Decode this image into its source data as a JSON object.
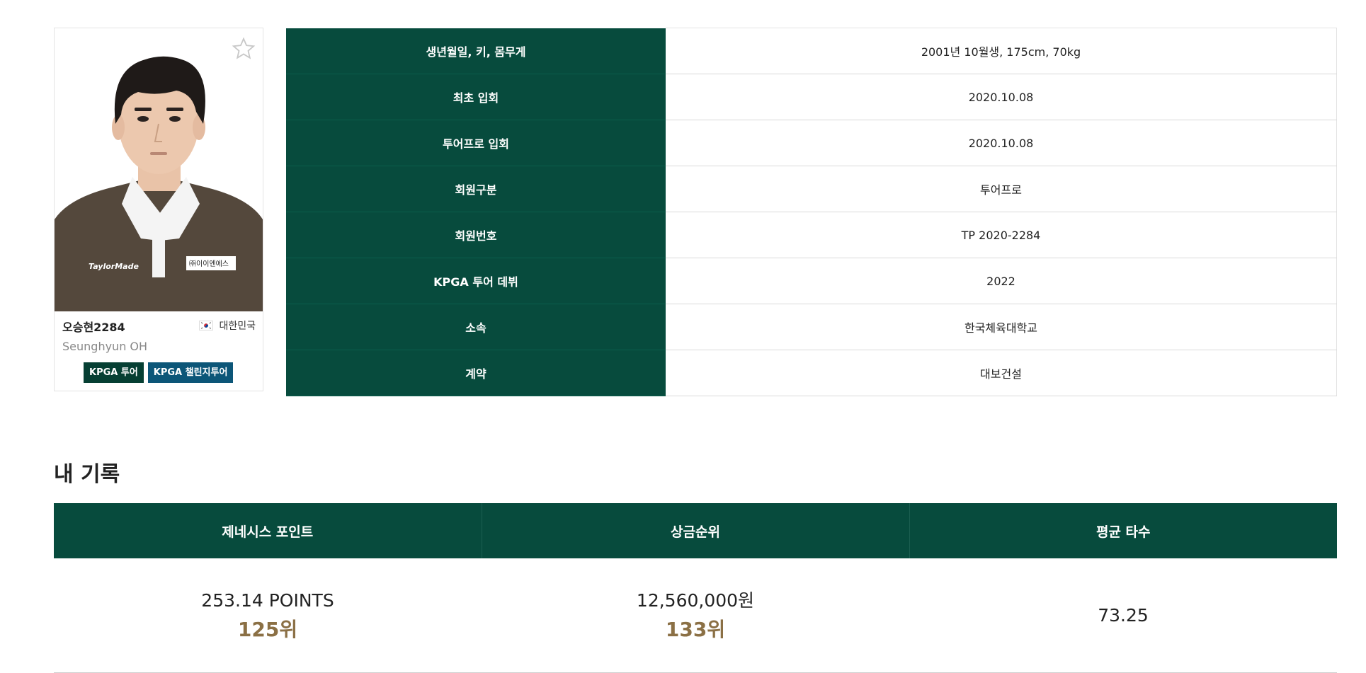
{
  "profile": {
    "name_kr": "오승현2284",
    "name_en": "Seunghyun OH",
    "nationality": "대한민국",
    "tags": [
      "KPGA 투어",
      "KPGA 챌린지투어"
    ],
    "shirt_brand": "TaylorMade",
    "shirt_sponsor": "㈜이이엔에스"
  },
  "info": [
    {
      "label": "생년월일, 키, 몸무게",
      "value": "2001년 10월생, 175cm, 70kg"
    },
    {
      "label": "최초 입회",
      "value": "2020.10.08"
    },
    {
      "label": "투어프로 입회",
      "value": "2020.10.08"
    },
    {
      "label": "회원구분",
      "value": "투어프로"
    },
    {
      "label": "회원번호",
      "value": "TP 2020-2284"
    },
    {
      "label": "KPGA 투어 데뷔",
      "value": "2022"
    },
    {
      "label": "소속",
      "value": "한국체육대학교"
    },
    {
      "label": "계약",
      "value": "대보건설"
    }
  ],
  "records": {
    "title": "내 기록",
    "columns": [
      {
        "header": "제네시스 포인트",
        "value": "253.14 POINTS",
        "rank": "125위"
      },
      {
        "header": "상금순위",
        "value": "12,560,000원",
        "rank": "133위"
      },
      {
        "header": "평균 타수",
        "value": "73.25",
        "rank": ""
      }
    ]
  },
  "colors": {
    "primary": "#074b3d",
    "challenge": "#0c5678",
    "rank": "#8b7045"
  }
}
